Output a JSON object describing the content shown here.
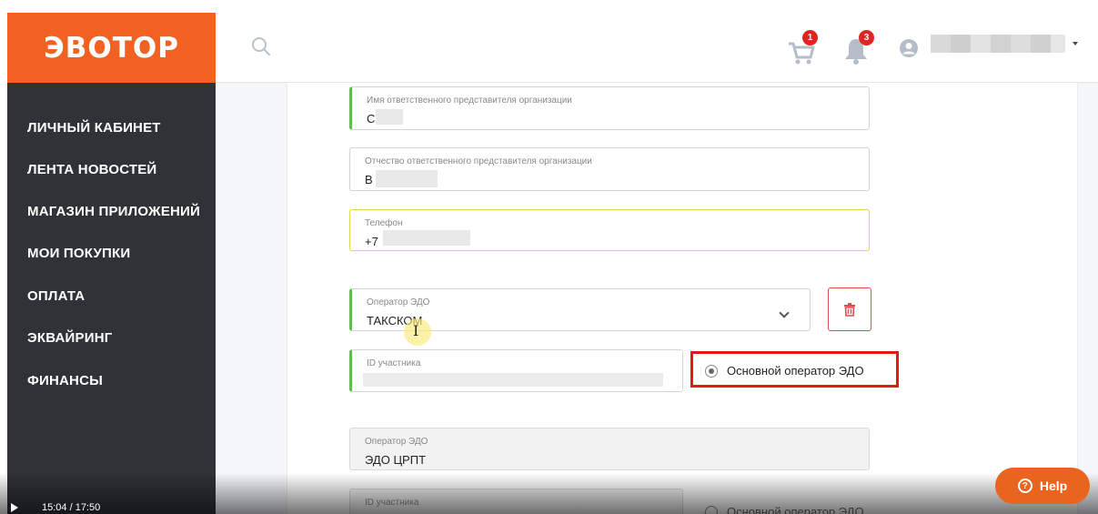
{
  "header": {
    "logo": "ЭВОТОР",
    "cart_badge": "1",
    "notifications_badge": "3",
    "brand_color": "#f26122"
  },
  "sidebar": {
    "items": [
      {
        "label": "ЛИЧНЫЙ КАБИНЕТ"
      },
      {
        "label": "ЛЕНТА НОВОСТЕЙ"
      },
      {
        "label": "МАГАЗИН ПРИЛОЖЕНИЙ"
      },
      {
        "label": "МОИ ПОКУПКИ"
      },
      {
        "label": "ОПЛАТА"
      },
      {
        "label": "ЭКВАЙРИНГ"
      },
      {
        "label": "ФИНАНСЫ"
      }
    ]
  },
  "form": {
    "first_name": {
      "label": "Имя ответственного представителя организации",
      "value": "С"
    },
    "patronymic": {
      "label": "Отчество ответственного представителя организации",
      "value": "В"
    },
    "phone": {
      "label": "Телефон",
      "value": "+7"
    },
    "operator1": {
      "label": "Оператор ЭДО",
      "value": "ТАКСКОМ"
    },
    "participant1": {
      "label": "ID участника",
      "value": ""
    },
    "primary_radio1": {
      "label": "Основной оператор ЭДО",
      "selected": true
    },
    "operator2": {
      "label": "Оператор ЭДО",
      "value": "ЭДО ЦРПТ"
    },
    "participant2": {
      "label": "ID участника",
      "value": ""
    },
    "primary_radio2": {
      "label": "Основной оператор ЭДО",
      "selected": false
    }
  },
  "video": {
    "time": "15:04 / 17:50"
  },
  "help": {
    "label": "Help",
    "icon_glyph": "?"
  }
}
